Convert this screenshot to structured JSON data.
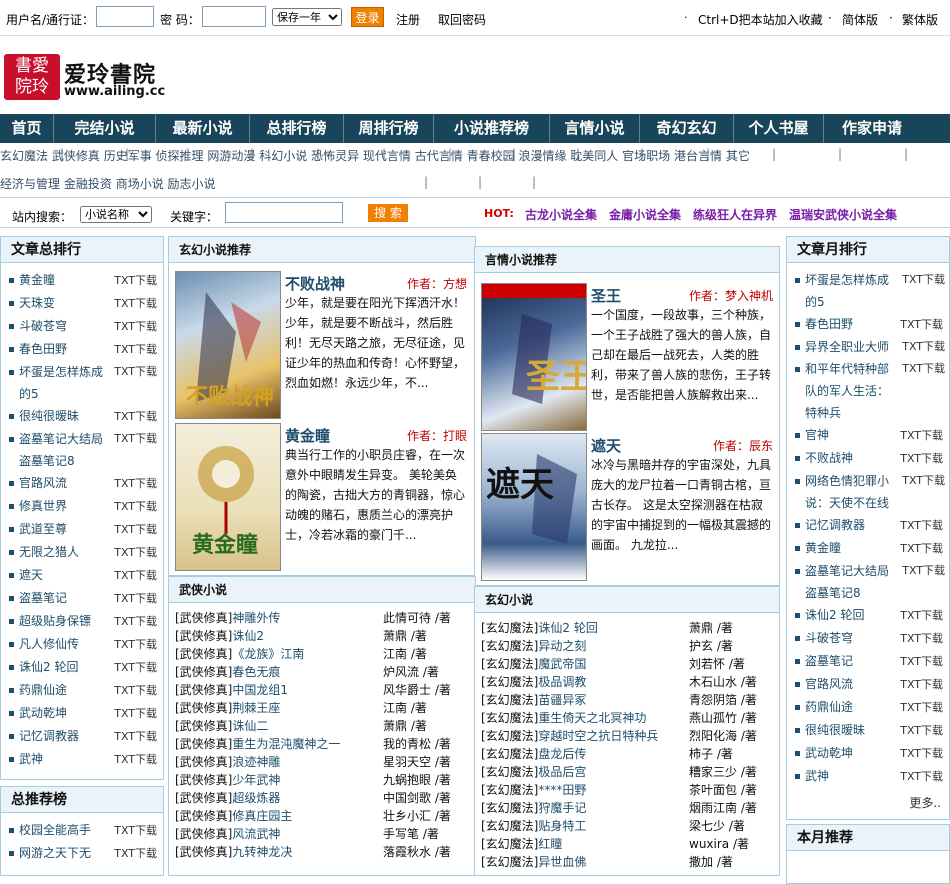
{
  "top": {
    "user_label": "用户名/通行证：",
    "pwd_label": "密 码：",
    "remember_select": "保存一年",
    "login_button": "登录",
    "register_link": "注册",
    "retrieve_link": "取回密码",
    "bookmark_text": "Ctrl+D把本站加入收藏",
    "simplified": "简体版",
    "traditional": "繁体版"
  },
  "logo": {
    "seal_line1": "書愛",
    "seal_line2": "院玲",
    "name": "爱玲書院",
    "url": "www.ailing.cc"
  },
  "nav": [
    "首页",
    "完结小说",
    "最新小说",
    "总排行榜",
    "周排行榜",
    "小说推荐榜",
    "言情小说",
    "奇幻玄幻",
    "个人书屋",
    "作家申请"
  ],
  "categories_row1": [
    "玄幻魔法",
    "武侠修真",
    "历史军事",
    "侦探推理",
    "网游动漫",
    "科幻小说",
    "恐怖灵异",
    "现代言情",
    "古代言情",
    "青春校园",
    "浪漫情缘",
    "耽美同人",
    "官场职场",
    "港台言情",
    "其它"
  ],
  "categories_row2": [
    "经济与管理",
    "金融投资",
    "商场小说",
    "励志小说"
  ],
  "search": {
    "label": "站内搜索：",
    "select": "小说名称",
    "keyword_label": "关键字：",
    "button": "搜 索",
    "hot_label": "HOT:",
    "hot_links": [
      "古龙小说全集",
      "金庸小说全集",
      "练级狂人在异界",
      "温瑞安武侠小说全集"
    ]
  },
  "left_rank": {
    "title": "文章总排行",
    "dl": "TXT下载",
    "items": [
      "黄金瞳",
      "天珠变",
      "斗破苍穹",
      "春色田野",
      "坏蛋是怎样炼成的5",
      "很纯很暧昧",
      "盗墓笔记大结局 盗墓笔记8",
      "官路风流",
      "修真世界",
      "武道至尊",
      "无限之猎人",
      "遮天",
      "盗墓笔记",
      "超级贴身保镖",
      "凡人修仙传",
      "诛仙2 轮回",
      "药鼎仙途",
      "武动乾坤",
      "记忆调教器",
      "武神"
    ]
  },
  "left_recommend": {
    "title": "总推荐榜",
    "items": [
      "校园全能高手",
      "网游之天下无"
    ]
  },
  "xuanhuan_rec": {
    "title": "玄幻小说推荐",
    "books": [
      {
        "title": "不败战神",
        "author": "作者：方想",
        "desc": "少年，就是要在阳光下挥洒汗水！少年，就是要不断战斗，然后胜利！无尽天路之旅，无尽征途，见证少年的热血和传奇！心怀野望，烈血如燃！永远少年，不...",
        "cover": "不败战神"
      },
      {
        "title": "黄金瞳",
        "author": "作者：打眼",
        "desc": "典当行工作的小职员庄睿，在一次意外中眼睛发生异变。 美轮美奂的陶瓷，古拙大方的青铜器，惊心动魄的赌石，惠质兰心的漂亮护士，冷若冰霜的豪门千...",
        "cover": "黄金瞳"
      }
    ]
  },
  "yanqing_rec": {
    "title": "言情小说推荐",
    "books": [
      {
        "title": "圣王",
        "author": "作者：梦入神机",
        "desc": "一个国度，一段故事，三个种族，一个王子战胜了强大的兽人族，自己却在最后一战死去，人类的胜利，带来了兽人族的悲伤，王子转世，是否能把兽人族解救出来...",
        "cover": "圣王"
      },
      {
        "title": "遮天",
        "author": "作者：辰东",
        "desc": "冰冷与黑暗并存的宇宙深处，九具庞大的龙尸拉着一口青铜古棺，亘古长存。 这是太空探测器在枯寂的宇宙中捕捉到的一幅极其震撼的画面。 九龙拉...",
        "cover": "遮天"
      }
    ]
  },
  "wuxia_list": {
    "title": "武侠小说",
    "cat": "[武侠修真]",
    "items": [
      {
        "t": "神雕外传",
        "a": "此情可待 /著"
      },
      {
        "t": "诛仙2",
        "a": "萧鼎 /著"
      },
      {
        "t": "《龙族》江南",
        "a": "江南 /著"
      },
      {
        "t": "春色无痕",
        "a": "炉风流 /著"
      },
      {
        "t": "中国龙组1",
        "a": "风华爵士 /著"
      },
      {
        "t": "荆棘王座",
        "a": "江南 /著"
      },
      {
        "t": "诛仙二",
        "a": "萧鼎 /著"
      },
      {
        "t": "重生为混沌魔神之一",
        "a": "我的青松 /著"
      },
      {
        "t": "浪迹神雕",
        "a": "星羽天空 /著"
      },
      {
        "t": "少年武神",
        "a": "九蜗抱眼 /著"
      },
      {
        "t": "超级炼器",
        "a": "中国剑歌 /著"
      },
      {
        "t": "修真庄园主",
        "a": "壮乡小汇 /著"
      },
      {
        "t": "风流武神",
        "a": "手写笔 /著"
      },
      {
        "t": "九转神龙决",
        "a": "落霞秋水 /著"
      }
    ]
  },
  "xuanhuan_list": {
    "title": "玄幻小说",
    "cat": "[玄幻魔法]",
    "items": [
      {
        "t": "诛仙2 轮回",
        "a": "萧鼎 /著"
      },
      {
        "t": "异动之刻",
        "a": "护玄 /著"
      },
      {
        "t": "魔武帝国",
        "a": "刘若怀 /著"
      },
      {
        "t": "极品调教",
        "a": "木石山水 /著"
      },
      {
        "t": "苗疆异冢",
        "a": "青怨阴箔 /著"
      },
      {
        "t": "重生倚天之北冥神功",
        "a": "燕山孤竹 /著"
      },
      {
        "t": "穿越时空之抗日特种兵",
        "a": "烈阳化海 /著"
      },
      {
        "t": "盘龙后传",
        "a": "柿子 /著"
      },
      {
        "t": "极品后宫",
        "a": "糟家三少 /著"
      },
      {
        "t": "****田野",
        "a": "茶叶面包 /著"
      },
      {
        "t": "狩魔手记",
        "a": "烟雨江南 /著"
      },
      {
        "t": "贴身特工",
        "a": "梁七少 /著"
      },
      {
        "t": "红瞳",
        "a": "wuxira /著"
      },
      {
        "t": "异世血佛",
        "a": "撒加 /著"
      }
    ]
  },
  "right_rank": {
    "title": "文章月排行",
    "dl": "TXT下载",
    "items": [
      "坏蛋是怎样炼成的5",
      "春色田野",
      "异界全职业大师",
      "和平年代特种部队的军人生活：特种兵",
      "官神",
      "不败战神",
      "网络色情犯罪小说：天使不在线",
      "记忆调教器",
      "黄金瞳",
      "盗墓笔记大结局 盗墓笔记8",
      "诛仙2 轮回",
      "斗破苍穹",
      "盗墓笔记",
      "官路风流",
      "药鼎仙途",
      "很纯很暧昧",
      "武动乾坤",
      "武神"
    ],
    "more": "更多.."
  },
  "right_recommend": {
    "title": "本月推荐"
  }
}
